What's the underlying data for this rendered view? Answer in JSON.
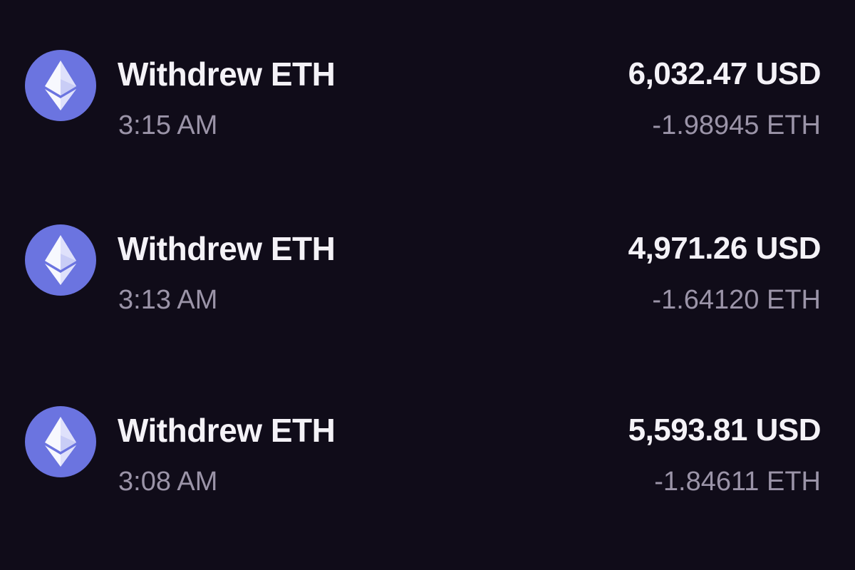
{
  "transactions": [
    {
      "icon": "ethereum-icon",
      "title": "Withdrew ETH",
      "time": "3:15 AM",
      "usd_amount": "6,032.47 USD",
      "eth_amount": "-1.98945 ETH"
    },
    {
      "icon": "ethereum-icon",
      "title": "Withdrew ETH",
      "time": "3:13 AM",
      "usd_amount": "4,971.26 USD",
      "eth_amount": "-1.64120 ETH"
    },
    {
      "icon": "ethereum-icon",
      "title": "Withdrew ETH",
      "time": "3:08 AM",
      "usd_amount": "5,593.81 USD",
      "eth_amount": "-1.84611 ETH"
    }
  ],
  "colors": {
    "background": "#100c19",
    "icon_circle": "#6b74e0",
    "primary_text": "#f4f2f7",
    "secondary_text": "#9b94a8"
  }
}
